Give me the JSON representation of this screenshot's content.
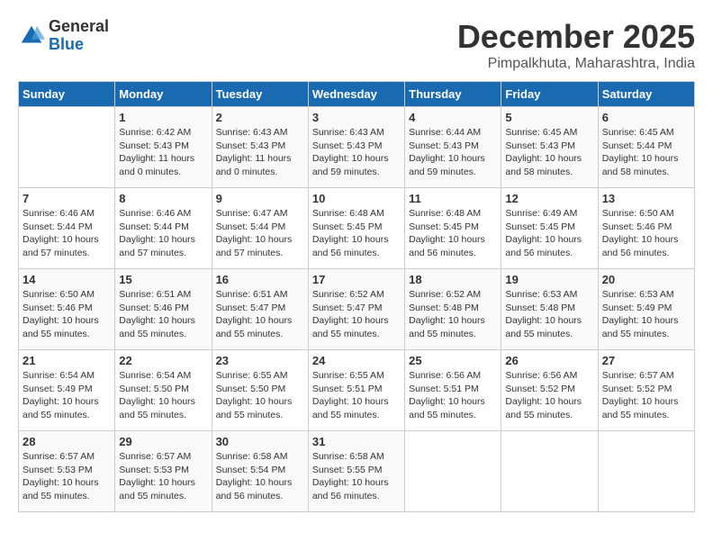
{
  "logo": {
    "general": "General",
    "blue": "Blue"
  },
  "title": "December 2025",
  "subtitle": "Pimpalkhuta, Maharashtra, India",
  "headers": [
    "Sunday",
    "Monday",
    "Tuesday",
    "Wednesday",
    "Thursday",
    "Friday",
    "Saturday"
  ],
  "weeks": [
    [
      {
        "day": "",
        "sunrise": "",
        "sunset": "",
        "daylight": ""
      },
      {
        "day": "1",
        "sunrise": "Sunrise: 6:42 AM",
        "sunset": "Sunset: 5:43 PM",
        "daylight": "Daylight: 11 hours and 0 minutes."
      },
      {
        "day": "2",
        "sunrise": "Sunrise: 6:43 AM",
        "sunset": "Sunset: 5:43 PM",
        "daylight": "Daylight: 11 hours and 0 minutes."
      },
      {
        "day": "3",
        "sunrise": "Sunrise: 6:43 AM",
        "sunset": "Sunset: 5:43 PM",
        "daylight": "Daylight: 10 hours and 59 minutes."
      },
      {
        "day": "4",
        "sunrise": "Sunrise: 6:44 AM",
        "sunset": "Sunset: 5:43 PM",
        "daylight": "Daylight: 10 hours and 59 minutes."
      },
      {
        "day": "5",
        "sunrise": "Sunrise: 6:45 AM",
        "sunset": "Sunset: 5:43 PM",
        "daylight": "Daylight: 10 hours and 58 minutes."
      },
      {
        "day": "6",
        "sunrise": "Sunrise: 6:45 AM",
        "sunset": "Sunset: 5:44 PM",
        "daylight": "Daylight: 10 hours and 58 minutes."
      }
    ],
    [
      {
        "day": "7",
        "sunrise": "Sunrise: 6:46 AM",
        "sunset": "Sunset: 5:44 PM",
        "daylight": "Daylight: 10 hours and 57 minutes."
      },
      {
        "day": "8",
        "sunrise": "Sunrise: 6:46 AM",
        "sunset": "Sunset: 5:44 PM",
        "daylight": "Daylight: 10 hours and 57 minutes."
      },
      {
        "day": "9",
        "sunrise": "Sunrise: 6:47 AM",
        "sunset": "Sunset: 5:44 PM",
        "daylight": "Daylight: 10 hours and 57 minutes."
      },
      {
        "day": "10",
        "sunrise": "Sunrise: 6:48 AM",
        "sunset": "Sunset: 5:45 PM",
        "daylight": "Daylight: 10 hours and 56 minutes."
      },
      {
        "day": "11",
        "sunrise": "Sunrise: 6:48 AM",
        "sunset": "Sunset: 5:45 PM",
        "daylight": "Daylight: 10 hours and 56 minutes."
      },
      {
        "day": "12",
        "sunrise": "Sunrise: 6:49 AM",
        "sunset": "Sunset: 5:45 PM",
        "daylight": "Daylight: 10 hours and 56 minutes."
      },
      {
        "day": "13",
        "sunrise": "Sunrise: 6:50 AM",
        "sunset": "Sunset: 5:46 PM",
        "daylight": "Daylight: 10 hours and 56 minutes."
      }
    ],
    [
      {
        "day": "14",
        "sunrise": "Sunrise: 6:50 AM",
        "sunset": "Sunset: 5:46 PM",
        "daylight": "Daylight: 10 hours and 55 minutes."
      },
      {
        "day": "15",
        "sunrise": "Sunrise: 6:51 AM",
        "sunset": "Sunset: 5:46 PM",
        "daylight": "Daylight: 10 hours and 55 minutes."
      },
      {
        "day": "16",
        "sunrise": "Sunrise: 6:51 AM",
        "sunset": "Sunset: 5:47 PM",
        "daylight": "Daylight: 10 hours and 55 minutes."
      },
      {
        "day": "17",
        "sunrise": "Sunrise: 6:52 AM",
        "sunset": "Sunset: 5:47 PM",
        "daylight": "Daylight: 10 hours and 55 minutes."
      },
      {
        "day": "18",
        "sunrise": "Sunrise: 6:52 AM",
        "sunset": "Sunset: 5:48 PM",
        "daylight": "Daylight: 10 hours and 55 minutes."
      },
      {
        "day": "19",
        "sunrise": "Sunrise: 6:53 AM",
        "sunset": "Sunset: 5:48 PM",
        "daylight": "Daylight: 10 hours and 55 minutes."
      },
      {
        "day": "20",
        "sunrise": "Sunrise: 6:53 AM",
        "sunset": "Sunset: 5:49 PM",
        "daylight": "Daylight: 10 hours and 55 minutes."
      }
    ],
    [
      {
        "day": "21",
        "sunrise": "Sunrise: 6:54 AM",
        "sunset": "Sunset: 5:49 PM",
        "daylight": "Daylight: 10 hours and 55 minutes."
      },
      {
        "day": "22",
        "sunrise": "Sunrise: 6:54 AM",
        "sunset": "Sunset: 5:50 PM",
        "daylight": "Daylight: 10 hours and 55 minutes."
      },
      {
        "day": "23",
        "sunrise": "Sunrise: 6:55 AM",
        "sunset": "Sunset: 5:50 PM",
        "daylight": "Daylight: 10 hours and 55 minutes."
      },
      {
        "day": "24",
        "sunrise": "Sunrise: 6:55 AM",
        "sunset": "Sunset: 5:51 PM",
        "daylight": "Daylight: 10 hours and 55 minutes."
      },
      {
        "day": "25",
        "sunrise": "Sunrise: 6:56 AM",
        "sunset": "Sunset: 5:51 PM",
        "daylight": "Daylight: 10 hours and 55 minutes."
      },
      {
        "day": "26",
        "sunrise": "Sunrise: 6:56 AM",
        "sunset": "Sunset: 5:52 PM",
        "daylight": "Daylight: 10 hours and 55 minutes."
      },
      {
        "day": "27",
        "sunrise": "Sunrise: 6:57 AM",
        "sunset": "Sunset: 5:52 PM",
        "daylight": "Daylight: 10 hours and 55 minutes."
      }
    ],
    [
      {
        "day": "28",
        "sunrise": "Sunrise: 6:57 AM",
        "sunset": "Sunset: 5:53 PM",
        "daylight": "Daylight: 10 hours and 55 minutes."
      },
      {
        "day": "29",
        "sunrise": "Sunrise: 6:57 AM",
        "sunset": "Sunset: 5:53 PM",
        "daylight": "Daylight: 10 hours and 55 minutes."
      },
      {
        "day": "30",
        "sunrise": "Sunrise: 6:58 AM",
        "sunset": "Sunset: 5:54 PM",
        "daylight": "Daylight: 10 hours and 56 minutes."
      },
      {
        "day": "31",
        "sunrise": "Sunrise: 6:58 AM",
        "sunset": "Sunset: 5:55 PM",
        "daylight": "Daylight: 10 hours and 56 minutes."
      },
      {
        "day": "",
        "sunrise": "",
        "sunset": "",
        "daylight": ""
      },
      {
        "day": "",
        "sunrise": "",
        "sunset": "",
        "daylight": ""
      },
      {
        "day": "",
        "sunrise": "",
        "sunset": "",
        "daylight": ""
      }
    ]
  ]
}
